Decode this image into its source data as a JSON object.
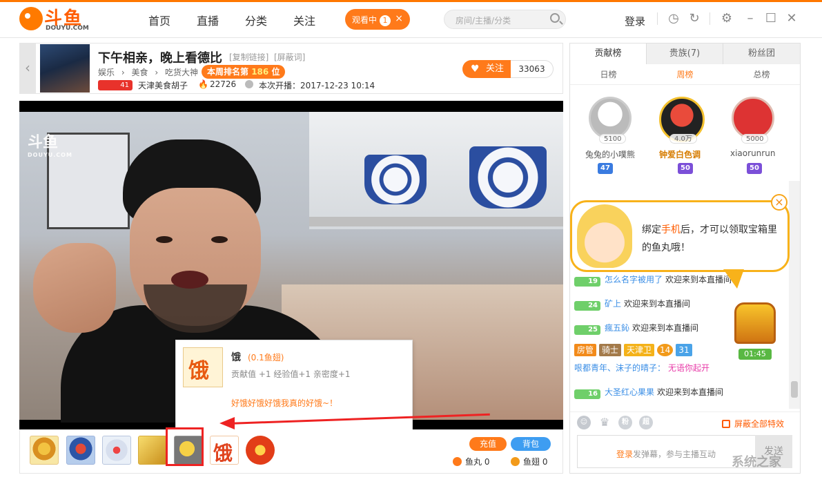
{
  "header": {
    "logo_text": "斗鱼",
    "logo_sub": "DOUYU.COM",
    "nav": [
      "首页",
      "直播",
      "分类",
      "关注"
    ],
    "watching_label": "观看中",
    "watching_count": "1",
    "search_placeholder": "房间/主播/分类",
    "login": "登录"
  },
  "room": {
    "title": "下午相亲，晚上看德比",
    "copy_link": "[复制链接]",
    "shield_room": "[屏蔽词]",
    "breadcrumb": [
      "娱乐",
      "›",
      "美食",
      "›",
      "吃货大神"
    ],
    "rank_prefix": "本周排名第",
    "rank_value": "186",
    "rank_suffix": "位",
    "anchor_level": "41",
    "anchor_name": "天津美食胡子",
    "heat": "22726",
    "start_label": "本次开播：2017-12-23 10:14",
    "follow_label": "关注",
    "follow_count": "33063"
  },
  "video": {
    "logo": "斗鱼",
    "logo_sub": "DOUYU.COM"
  },
  "gift_popup": {
    "icon_text": "饿",
    "name": "饿",
    "price": "(0.1鱼翅)",
    "stats": "贡献值 +1 经验值+1 亲密度+1",
    "desc": "好饿好饿好饿我真的好饿~！"
  },
  "gift_bar": {
    "g6_text": "饿",
    "recharge": "充值",
    "backpack": "背包",
    "yuwan": "鱼丸 0",
    "yuchi": "鱼翅 0"
  },
  "sidebar": {
    "tabs": [
      "贡献榜",
      "贵族(7)",
      "粉丝团"
    ],
    "subtabs": [
      "日榜",
      "周榜",
      "总榜"
    ],
    "top3": [
      {
        "name": "兔兔的小噗熊",
        "points": "5100",
        "badge": "47"
      },
      {
        "name": "钟爱白色调",
        "points": "4.0万",
        "badge": "50"
      },
      {
        "name": "xiaorunrun",
        "points": "5000",
        "badge": "50"
      }
    ]
  },
  "chat": {
    "bubble_pre": "绑定",
    "bubble_hl": "手机",
    "bubble_post": "后，才可以领取宝箱里的鱼丸哦！",
    "chest_time": "01:45",
    "messages": [
      {
        "lv": "19",
        "nick": "怎么名字被用了",
        "text": "欢迎来到本直播间"
      },
      {
        "lv": "24",
        "nick": "矿上",
        "text": "欢迎来到本直播间"
      },
      {
        "lv": "25",
        "nick": "瘋五鈊",
        "text": "欢迎来到本直播间"
      },
      {
        "lv": "16",
        "nick": "大圣红心果果",
        "text": "欢迎来到本直播间"
      }
    ],
    "vip_tags": [
      "房管",
      "骑士",
      "天津卫",
      "14",
      "31"
    ],
    "vip_nick": "哏都青年、沫子的晴子：",
    "vip_text": "无语你起开",
    "shield_fx": "屏蔽全部特效",
    "input_login": "登录",
    "input_ph": "发弹幕，参与主播互动",
    "send": "发送",
    "watermark": "系统之家"
  },
  "colors": {
    "brand": "#ff7a1a",
    "highlight_box": "#e22222"
  }
}
